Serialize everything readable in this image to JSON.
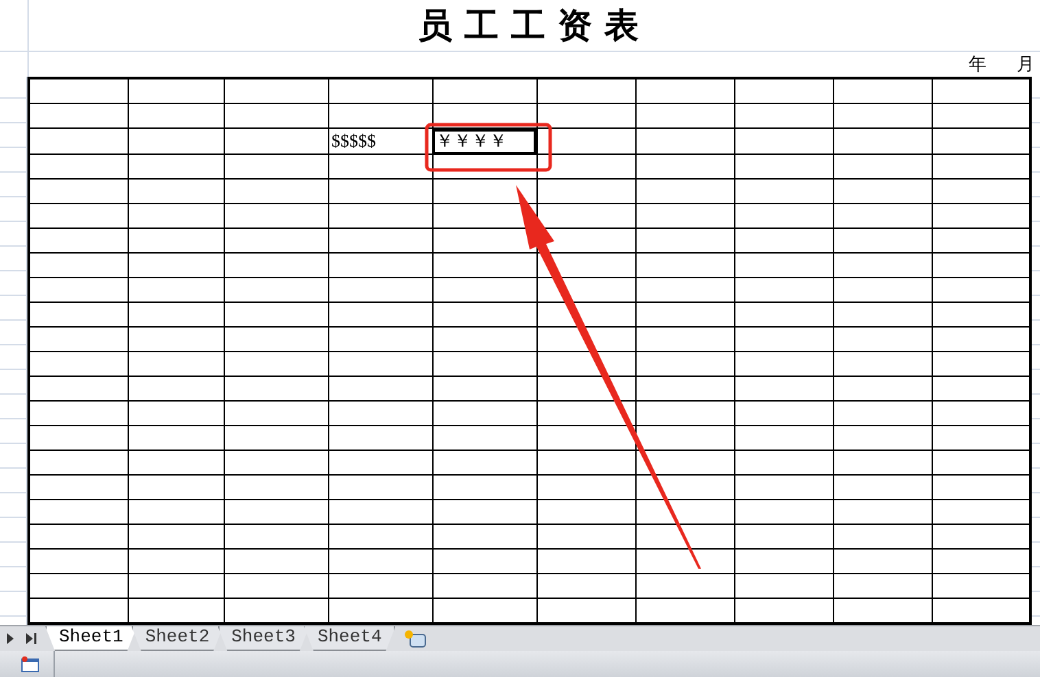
{
  "title": "员工工资表",
  "date_labels": [
    "年",
    "月"
  ],
  "table": {
    "filled_row": [
      {
        "text": "$$$$$",
        "selected": false
      },
      {
        "text": "￥￥￥￥",
        "selected": true
      }
    ]
  },
  "sheet_tabs": [
    {
      "label": "Sheet1",
      "selected": true
    },
    {
      "label": "Sheet2",
      "selected": false
    },
    {
      "label": "Sheet3",
      "selected": false
    },
    {
      "label": "Sheet4",
      "selected": false
    }
  ]
}
